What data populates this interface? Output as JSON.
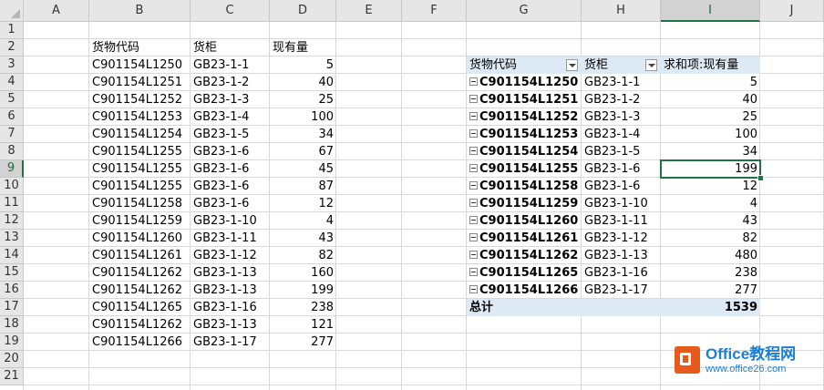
{
  "columns": [
    "A",
    "B",
    "C",
    "D",
    "E",
    "F",
    "G",
    "H",
    "I",
    "J"
  ],
  "selected_column": "I",
  "selected_row": "9",
  "rows": [
    "1",
    "2",
    "3",
    "4",
    "5",
    "6",
    "7",
    "8",
    "9",
    "10",
    "11",
    "12",
    "13",
    "14",
    "15",
    "16",
    "17",
    "18",
    "19",
    "20",
    "21"
  ],
  "source_table": {
    "headers": [
      "货物代码",
      "货柜",
      "现有量"
    ],
    "rows": [
      [
        "C901154L1250",
        "GB23-1-1",
        "5"
      ],
      [
        "C901154L1251",
        "GB23-1-2",
        "40"
      ],
      [
        "C901154L1252",
        "GB23-1-3",
        "25"
      ],
      [
        "C901154L1253",
        "GB23-1-4",
        "100"
      ],
      [
        "C901154L1254",
        "GB23-1-5",
        "34"
      ],
      [
        "C901154L1255",
        "GB23-1-6",
        "67"
      ],
      [
        "C901154L1255",
        "GB23-1-6",
        "45"
      ],
      [
        "C901154L1255",
        "GB23-1-6",
        "87"
      ],
      [
        "C901154L1258",
        "GB23-1-6",
        "12"
      ],
      [
        "C901154L1259",
        "GB23-1-10",
        "4"
      ],
      [
        "C901154L1260",
        "GB23-1-11",
        "43"
      ],
      [
        "C901154L1261",
        "GB23-1-12",
        "82"
      ],
      [
        "C901154L1262",
        "GB23-1-13",
        "160"
      ],
      [
        "C901154L1262",
        "GB23-1-13",
        "199"
      ],
      [
        "C901154L1265",
        "GB23-1-16",
        "238"
      ],
      [
        "C901154L1262",
        "GB23-1-13",
        "121"
      ],
      [
        "C901154L1266",
        "GB23-1-17",
        "277"
      ]
    ]
  },
  "pivot": {
    "headers": [
      "货物代码",
      "货柜",
      "求和项:现有量"
    ],
    "rows": [
      [
        "C901154L1250",
        "GB23-1-1",
        "5"
      ],
      [
        "C901154L1251",
        "GB23-1-2",
        "40"
      ],
      [
        "C901154L1252",
        "GB23-1-3",
        "25"
      ],
      [
        "C901154L1253",
        "GB23-1-4",
        "100"
      ],
      [
        "C901154L1254",
        "GB23-1-5",
        "34"
      ],
      [
        "C901154L1255",
        "GB23-1-6",
        "199"
      ],
      [
        "C901154L1258",
        "GB23-1-6",
        "12"
      ],
      [
        "C901154L1259",
        "GB23-1-10",
        "4"
      ],
      [
        "C901154L1260",
        "GB23-1-11",
        "43"
      ],
      [
        "C901154L1261",
        "GB23-1-12",
        "82"
      ],
      [
        "C901154L1262",
        "GB23-1-13",
        "480"
      ],
      [
        "C901154L1265",
        "GB23-1-16",
        "238"
      ],
      [
        "C901154L1266",
        "GB23-1-17",
        "277"
      ]
    ],
    "total_label": "总计",
    "total_value": "1539"
  },
  "watermark": {
    "title": "Office教程网",
    "url": "www.office26.com"
  },
  "colors": {
    "accent": "#217346",
    "pivot_header": "#dde9f5",
    "watermark": "#1b7fd4",
    "logo": "#e65a1c"
  }
}
